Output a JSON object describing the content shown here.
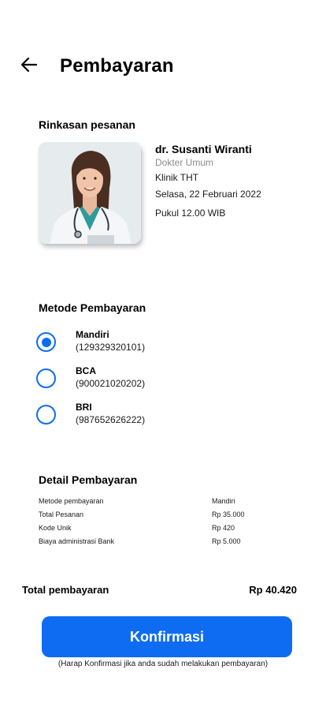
{
  "header": {
    "title": "Pembayaran",
    "back_icon": "arrow-left-icon"
  },
  "summary": {
    "section_title": "Rinkasan pesanan",
    "doctor_name": "dr. Susanti Wiranti",
    "doctor_role": "Dokter Umum",
    "clinic": "Klinik THT",
    "date": "Selasa, 22 Februari 2022",
    "time": "Pukul 12.00 WIB"
  },
  "payment_methods": {
    "section_title": "Metode Pembayaran",
    "items": [
      {
        "name": "Mandiri",
        "account": "(129329320101)",
        "selected": true
      },
      {
        "name": "BCA",
        "account": "(900021020202)",
        "selected": false
      },
      {
        "name": "BRI",
        "account": "(987652626222)",
        "selected": false
      }
    ]
  },
  "details": {
    "section_title": "Detail Pembayaran",
    "rows": [
      {
        "label": "Metode pembayaran",
        "value": "Mandiri"
      },
      {
        "label": "Total Pesanan",
        "value": "Rp 35.000"
      },
      {
        "label": "Kode Unik",
        "value": "Rp 420"
      },
      {
        "label": "Biaya administrasi Bank",
        "value": "Rp 5.000"
      }
    ]
  },
  "total": {
    "label": "Total pembayaran",
    "value": "Rp 40.420"
  },
  "confirm": {
    "button_label": "Konfirmasi",
    "note": "(Harap Konfirmasi jika anda sudah melakukan pembayaran)"
  },
  "colors": {
    "accent": "#0e6cf2",
    "muted_text": "#8a8a8a"
  }
}
